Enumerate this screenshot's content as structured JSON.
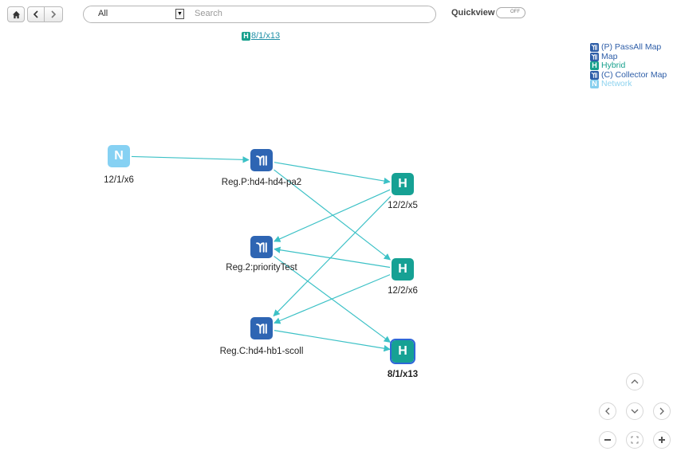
{
  "toolbar": {
    "home_icon": "home-icon",
    "back_icon": "back-arrow-icon",
    "forward_icon": "forward-arrow-icon",
    "scope_value": "All",
    "search_placeholder": "Search",
    "quickview_label": "Quickview",
    "quickview_state": "OFF"
  },
  "breadcrumb": {
    "badge": "H",
    "link": "8/1/x13"
  },
  "legend": {
    "items": [
      {
        "badge": "map-icon",
        "label": "(P) PassAll Map",
        "color": "#2e5ea8"
      },
      {
        "badge": "map-icon",
        "label": "Map",
        "color": "#2e5ea8"
      },
      {
        "badge": "H",
        "label": "Hybrid",
        "color": "#17a08d"
      },
      {
        "badge": "map-icon",
        "label": "(C) Collector Map",
        "color": "#2e5ea8"
      },
      {
        "badge": "N",
        "label": "Network",
        "color": "#87cfee"
      }
    ]
  },
  "graph": {
    "nodes": [
      {
        "id": "n1",
        "type": "network",
        "glyph": "N",
        "label": "12/1/x6"
      },
      {
        "id": "m1",
        "type": "map",
        "glyph": "map-icon",
        "label": "Reg.P:hd4-hd4-pa2"
      },
      {
        "id": "m2",
        "type": "map",
        "glyph": "map-icon",
        "label": "Reg.2:priorityTest"
      },
      {
        "id": "m3",
        "type": "map",
        "glyph": "map-icon",
        "label": "Reg.C:hd4-hb1-scoll"
      },
      {
        "id": "h1",
        "type": "hybrid",
        "glyph": "H",
        "label": "12/2/x5"
      },
      {
        "id": "h2",
        "type": "hybrid",
        "glyph": "H",
        "label": "12/2/x6"
      },
      {
        "id": "h3",
        "type": "hybrid",
        "glyph": "H",
        "label": "8/1/x13",
        "selected": true
      }
    ],
    "edges": [
      {
        "from": "n1",
        "to": "m1"
      },
      {
        "from": "m1",
        "to": "h1"
      },
      {
        "from": "m1",
        "to": "h2"
      },
      {
        "from": "h1",
        "to": "m2"
      },
      {
        "from": "h1",
        "to": "m3"
      },
      {
        "from": "h2",
        "to": "m2"
      },
      {
        "from": "h2",
        "to": "m3"
      },
      {
        "from": "m2",
        "to": "h3"
      },
      {
        "from": "m3",
        "to": "h3"
      }
    ],
    "edge_color": "#3cc1c6"
  },
  "controls": [
    "pan-up-icon",
    "pan-left-icon",
    "pan-down-icon",
    "pan-right-icon",
    "zoom-out-icon",
    "fit-to-screen-icon",
    "zoom-in-icon"
  ]
}
